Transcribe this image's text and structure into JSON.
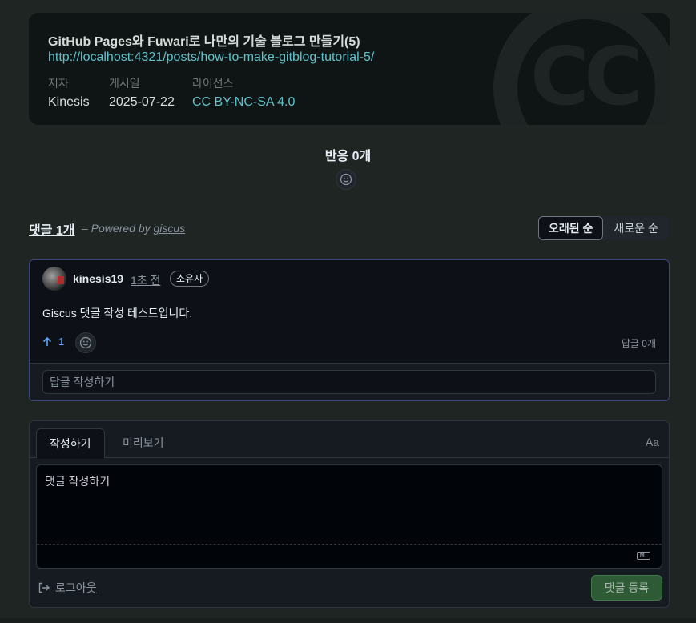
{
  "license": {
    "title": "GitHub Pages와 Fuwari로 나만의 기술 블로그 만들기(5)",
    "url": "http://localhost:4321/posts/how-to-make-gitblog-tutorial-5/",
    "author_label": "저자",
    "author": "Kinesis",
    "date_label": "게시일",
    "date": "2025-07-22",
    "license_label": "라이선스",
    "license_name": "CC BY-NC-SA 4.0",
    "watermark": "CC"
  },
  "reactions": {
    "title": "반응 0개"
  },
  "comments_header": {
    "count": "댓글 1개",
    "powered_prefix": "– Powered by ",
    "powered_link": "giscus",
    "sort_oldest": "오래된 순",
    "sort_newest": "새로운 순"
  },
  "comment": {
    "author": "kinesis19",
    "time": "1초 전",
    "badge": "소유자",
    "body": "Giscus 댓글 작성 테스트입니다.",
    "upvotes": "1",
    "reply_count": "답글 0개",
    "reply_placeholder": "답글 작성하기"
  },
  "composer": {
    "tab_write": "작성하기",
    "tab_preview": "미리보기",
    "font_toggle": "Aa",
    "placeholder": "댓글 작성하기",
    "md_badge": "M↓",
    "logout": "로그아웃",
    "submit": "댓글 등록"
  },
  "colors": {
    "accent_link": "#5fc3cd",
    "upvote": "#58a6ff",
    "submit_bg": "#2e5a35"
  }
}
